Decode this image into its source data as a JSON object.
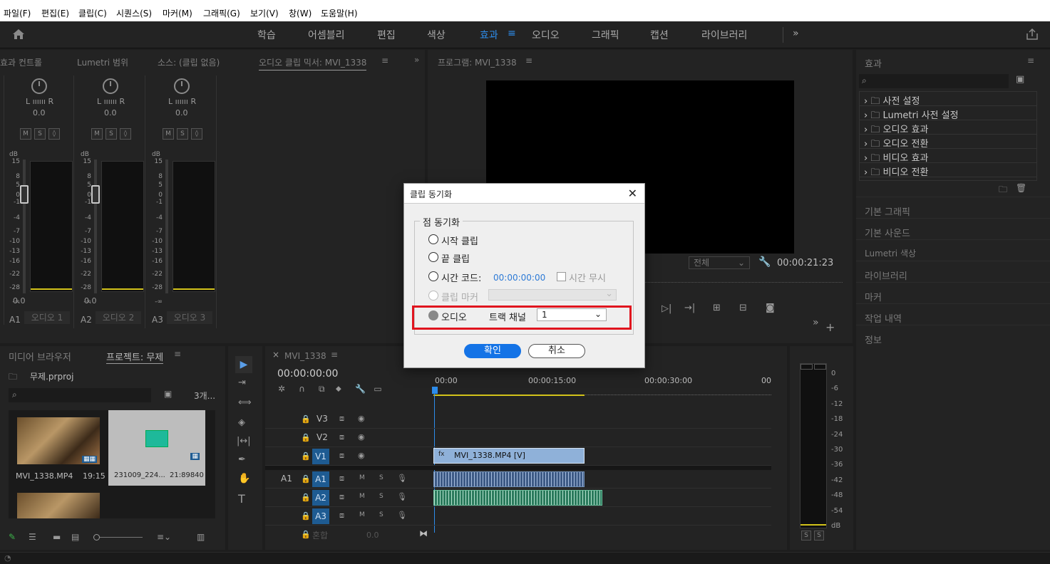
{
  "menu": [
    "파일(F)",
    "편집(E)",
    "클립(C)",
    "시퀀스(S)",
    "마커(M)",
    "그래픽(G)",
    "보기(V)",
    "창(W)",
    "도움말(H)"
  ],
  "workspaces": {
    "learn": "학습",
    "assembly": "어셈블리",
    "edit": "편집",
    "color": "색상",
    "effects": "효과",
    "audio": "오디오",
    "graphics": "그래픽",
    "captions": "캡션",
    "libraries": "라이브러리",
    "more": "»"
  },
  "top_left_tabs": {
    "effect_controls": "효과 컨트롤",
    "lumetri_scopes": "Lumetri 범위",
    "source": "소스: (클립 없음)",
    "audio_mixer": "오디오 클립 믹서: MVI_1338"
  },
  "mixer": {
    "lr": "L ıııııı R",
    "val": "0.0",
    "db": "dB",
    "scale": [
      "15",
      "8",
      "5",
      "0",
      "-1",
      "-4",
      "-7",
      "-10",
      "-13",
      "-16",
      "-22",
      "-28",
      "-∞"
    ],
    "bottom_val": "0.0",
    "channels": [
      {
        "id": "A1",
        "name": "오디오 1"
      },
      {
        "id": "A2",
        "name": "오디오 2"
      },
      {
        "id": "A3",
        "name": "오디오 3"
      }
    ],
    "m": "M",
    "s": "S",
    "r": "◊"
  },
  "program": {
    "title": "프로그램: MVI_1338",
    "zoom": "전체",
    "timecode": "00:00:21:23"
  },
  "project": {
    "media_browser": "미디어 브라우저",
    "tab": "프로젝트: 무제",
    "file": "무제.prproj",
    "count": "3개...",
    "items": [
      {
        "name": "MVI_1338.MP4",
        "dur": "19:15"
      },
      {
        "name": "231009_224...",
        "dur": "21:89840"
      }
    ]
  },
  "timeline": {
    "tab": "MVI_1338",
    "timecode": "00:00:00:00",
    "ruler": [
      "00:00",
      "00:00:15:00",
      "00:00:30:00",
      "00"
    ],
    "tracks_v": [
      "V3",
      "V2",
      "V1"
    ],
    "tracks_a": [
      "A1",
      "A2",
      "A3"
    ],
    "src_a1": "A1",
    "mix_label": "혼합",
    "mix_val": "0.0",
    "clip_v": "MVI_1338.MP4 [V]",
    "m": "M",
    "s": "S"
  },
  "effects_panel": {
    "title": "효과",
    "items": [
      "사전 설정",
      "Lumetri 사전 설정",
      "오디오 효과",
      "오디오 전환",
      "비디오 효과",
      "비디오 전환"
    ],
    "sections": [
      "기본 그래픽",
      "기본 사운드",
      "Lumetri 색상",
      "라이브러리",
      "마커",
      "작업 내역",
      "정보"
    ]
  },
  "meters": {
    "scale": [
      "0",
      "-6",
      "-12",
      "-18",
      "-24",
      "-30",
      "-36",
      "-42",
      "-48",
      "-54",
      "dB"
    ],
    "s": "S"
  },
  "dialog": {
    "title": "클립 동기화",
    "group": "점 동기화",
    "opt_start": "시작 클립",
    "opt_end": "끝 클립",
    "opt_timecode": "시간 코드:",
    "timecode_val": "00:00:00:00",
    "ignore_hours": "시간 무시",
    "opt_marker": "클립 마커",
    "opt_audio": "오디오",
    "track_channel": "트랙 채널",
    "channel_val": "1",
    "ok": "확인",
    "cancel": "취소"
  }
}
